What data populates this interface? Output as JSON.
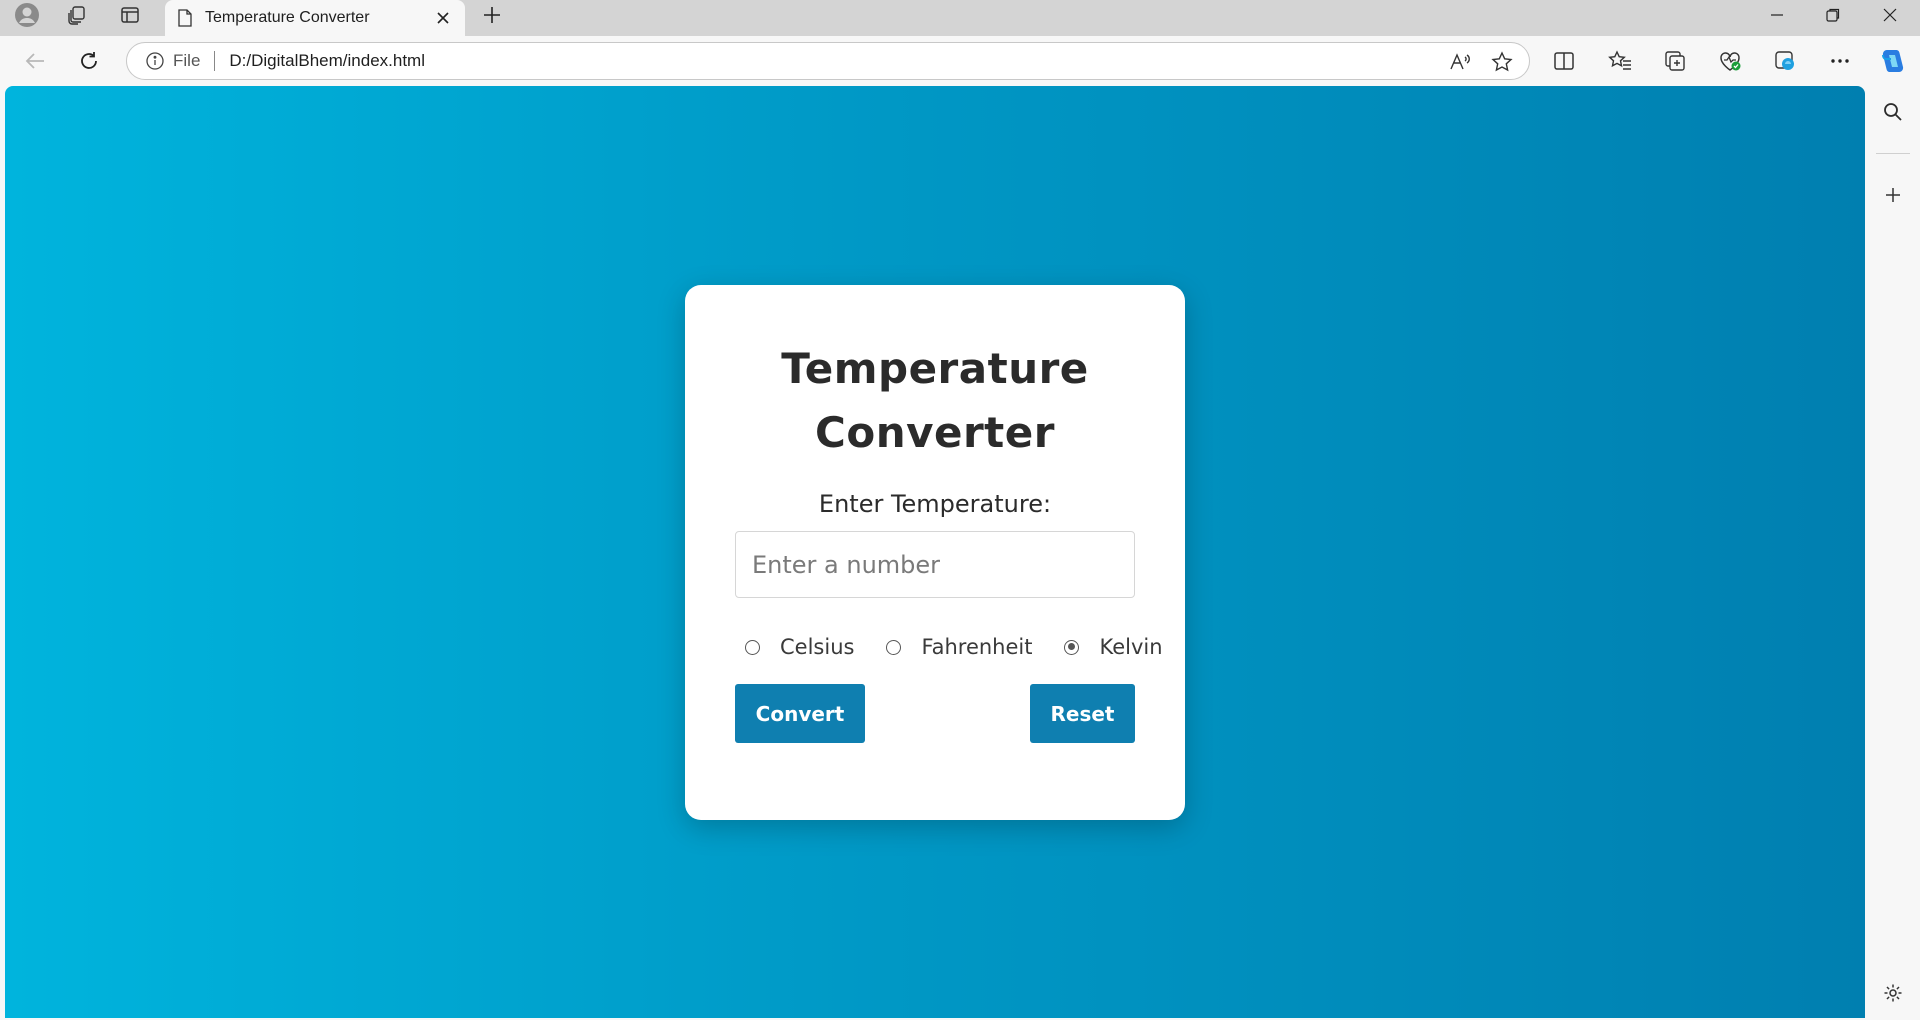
{
  "browser": {
    "tab": {
      "title": "Temperature Converter"
    },
    "address": {
      "scheme": "File",
      "url": "D:/DigitalBhem/index.html"
    }
  },
  "page": {
    "heading": "Temperature Converter",
    "input_label": "Enter Temperature:",
    "input_placeholder": "Enter a number",
    "input_value": "",
    "units": [
      {
        "label": "Celsius",
        "checked": false
      },
      {
        "label": "Fahrenheit",
        "checked": false
      },
      {
        "label": "Kelvin",
        "checked": true
      }
    ],
    "convert_label": "Convert",
    "reset_label": "Reset"
  },
  "colors": {
    "gradient_start": "#00b4dd",
    "gradient_end": "#007fb0",
    "button": "#0f7fb0",
    "card": "#ffffff"
  },
  "icons": {
    "tabstrip": [
      "profile-icon",
      "workspaces-icon",
      "tab-actions-icon",
      "page-icon",
      "close-icon",
      "new-tab-icon",
      "minimize-icon",
      "restore-icon",
      "close-window-icon"
    ],
    "toolbar": [
      "back-icon",
      "refresh-icon",
      "info-icon",
      "read-aloud-icon",
      "favorite-star-icon",
      "split-screen-icon",
      "favorites-icon",
      "collections-icon",
      "browser-essentials-icon",
      "edge-drop-icon",
      "more-icon",
      "copilot-icon"
    ],
    "sidebar": [
      "search-icon",
      "add-icon",
      "settings-icon"
    ]
  }
}
